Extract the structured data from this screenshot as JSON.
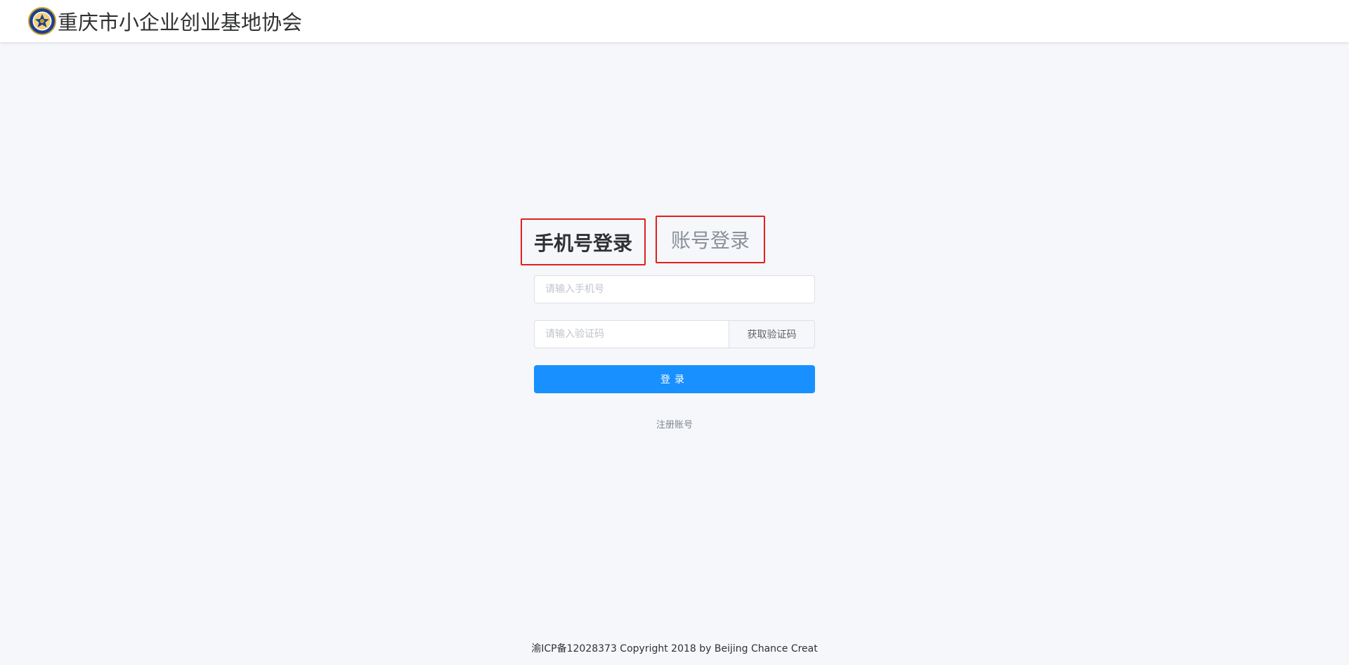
{
  "header": {
    "site_title": "重庆市小企业创业基地协会",
    "logo_icon": "association-emblem-icon"
  },
  "tabs": {
    "phone_login": "手机号登录",
    "account_login": "账号登录",
    "active": "phone_login"
  },
  "form": {
    "phone_placeholder": "请输入手机号",
    "phone_value": "",
    "code_placeholder": "请输入验证码",
    "code_value": "",
    "get_code_label": "获取验证码",
    "login_label": "登录",
    "register_label": "注册账号"
  },
  "footer": {
    "text": "渝ICP备12028373 Copyright 2018 by Beijing Chance Creat"
  },
  "colors": {
    "primary": "#1890ff",
    "highlight_border": "#e0201c",
    "background": "#f5f7fa",
    "logo_blue": "#1d3f8f",
    "logo_gold": "#c9a227"
  }
}
